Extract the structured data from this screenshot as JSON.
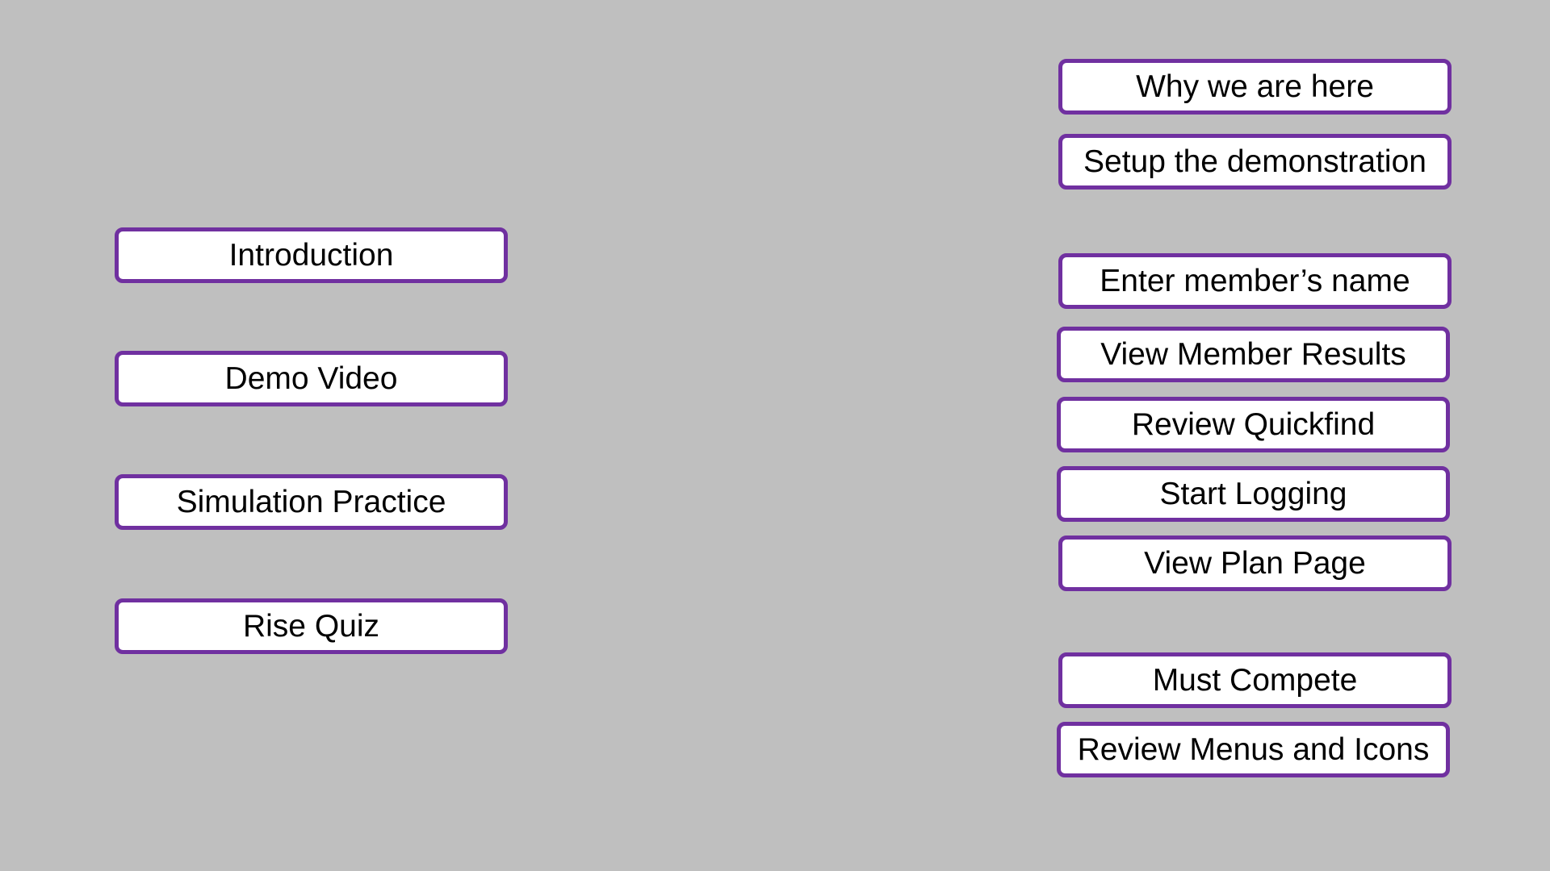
{
  "theme": {
    "background": "#bfbfbf",
    "button_border": "#7030a0",
    "button_fill": "#ffffff",
    "text_color": "#000000"
  },
  "left_menu": {
    "introduction": "Introduction",
    "demo_video": "Demo Video",
    "simulation_practice": "Simulation Practice",
    "rise_quiz": "Rise Quiz"
  },
  "right_menu": {
    "why_we_are_here": "Why we are here",
    "setup_demonstration": "Setup the demonstration",
    "enter_member_name": "Enter member’s name",
    "view_member_results": "View Member Results",
    "review_quickfind": "Review Quickfind",
    "start_logging": "Start Logging",
    "view_plan_page": "View Plan Page",
    "must_compete": "Must Compete",
    "review_menus_icons": "Review Menus and Icons"
  }
}
